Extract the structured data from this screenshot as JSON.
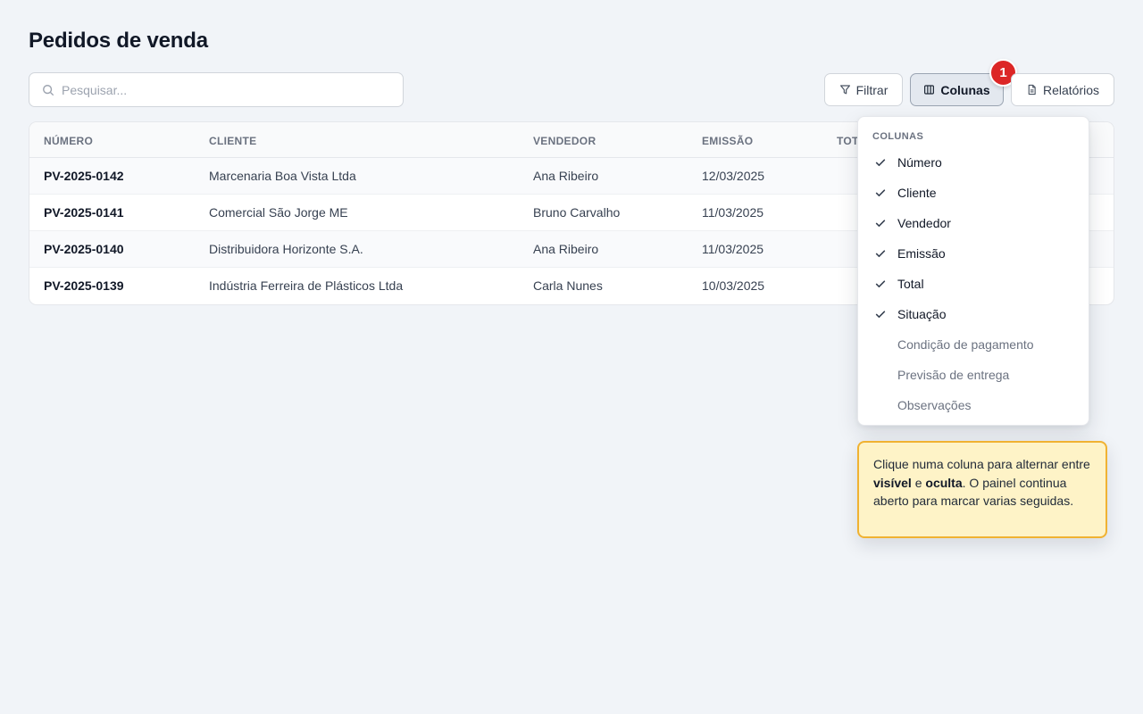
{
  "page": {
    "title": "Pedidos de venda"
  },
  "search": {
    "placeholder": "Pesquisar...",
    "value": ""
  },
  "toolbar": {
    "filter_label": "Filtrar",
    "columns_label": "Colunas",
    "columns_badge": "1",
    "reports_label": "Relatórios"
  },
  "table": {
    "headers": [
      "NÚMERO",
      "CLIENTE",
      "VENDEDOR",
      "EMISSÃO",
      "TOT"
    ],
    "rows": [
      {
        "numero": "PV-2025-0142",
        "cliente": "Marcenaria Boa Vista Ltda",
        "vendedor": "Ana Ribeiro",
        "emissao": "12/03/2025"
      },
      {
        "numero": "PV-2025-0141",
        "cliente": "Comercial São Jorge ME",
        "vendedor": "Bruno Carvalho",
        "emissao": "11/03/2025"
      },
      {
        "numero": "PV-2025-0140",
        "cliente": "Distribuidora Horizonte S.A.",
        "vendedor": "Ana Ribeiro",
        "emissao": "11/03/2025"
      },
      {
        "numero": "PV-2025-0139",
        "cliente": "Indústria Ferreira de Plásticos Ltda",
        "vendedor": "Carla Nunes",
        "emissao": "10/03/2025"
      }
    ]
  },
  "columns_menu": {
    "heading": "COLUNAS",
    "items": [
      {
        "label": "Número",
        "checked": true
      },
      {
        "label": "Cliente",
        "checked": true
      },
      {
        "label": "Vendedor",
        "checked": true
      },
      {
        "label": "Emissão",
        "checked": true
      },
      {
        "label": "Total",
        "checked": true
      },
      {
        "label": "Situação",
        "checked": true
      },
      {
        "label": "Condição de pagamento",
        "checked": false
      },
      {
        "label": "Previsão de entrega",
        "checked": false
      },
      {
        "label": "Observações",
        "checked": false
      }
    ]
  },
  "tooltip": {
    "part1": "Clique numa coluna para alternar entre ",
    "bold1": "visível",
    "part2": " e ",
    "bold2": "oculta",
    "part3": ". O painel continua aberto para marcar varias seguidas."
  },
  "colors": {
    "background": "#f1f4f8",
    "badge": "#dc2626",
    "tooltip_bg": "#fef3c7",
    "tooltip_border": "#f0b232",
    "check": "#374151"
  }
}
